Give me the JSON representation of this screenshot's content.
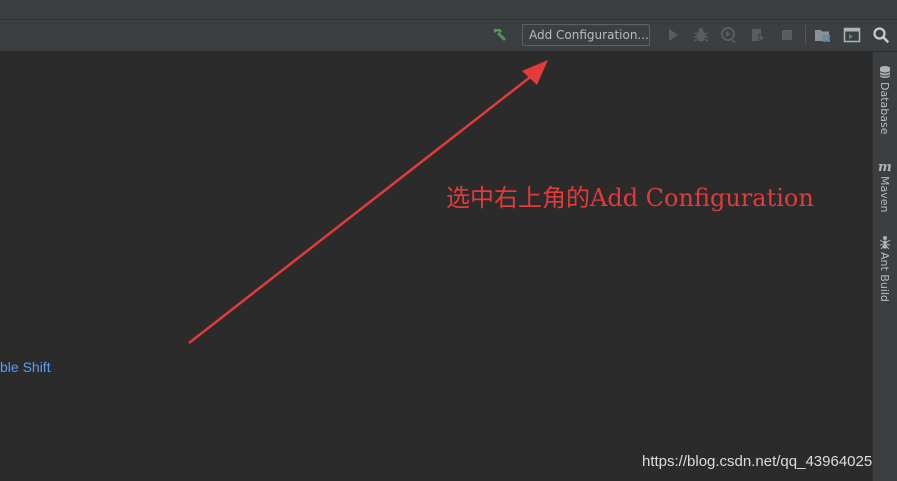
{
  "toolbar": {
    "config_label": "Add Configuration...",
    "icons": [
      "hammer-icon",
      "run-icon",
      "debug-icon",
      "coverage-icon",
      "profile-icon",
      "stop-icon",
      "project-structure-icon",
      "run-anything-icon",
      "search-icon"
    ]
  },
  "right_sidebar": {
    "tabs": [
      {
        "label": "Database",
        "icon": "database-icon"
      },
      {
        "label": "Maven",
        "icon": "maven-icon"
      },
      {
        "label": "Ant Build",
        "icon": "ant-icon"
      }
    ]
  },
  "editor": {
    "hint_fragment": "ble Shift"
  },
  "annotation": {
    "text": "选中右上角的Add Configuration",
    "color": "#e33a3a"
  },
  "watermark": "https://blog.csdn.net/qq_43964025",
  "colors": {
    "background": "#2b2b2b",
    "toolbar": "#3c3f41",
    "link_blue": "#589df6",
    "build_green": "#499c54"
  }
}
